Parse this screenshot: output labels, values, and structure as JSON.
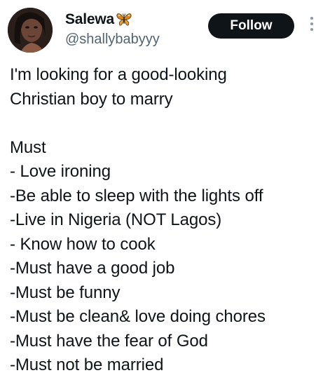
{
  "author": {
    "display_name": "Salewa",
    "name_emoji": "butterfly-icon",
    "handle": "@shallybabyyy"
  },
  "header": {
    "follow_label": "Follow"
  },
  "tweet": {
    "intro_lines": [
      "I'm looking for a good-looking",
      "Christian boy to marry"
    ],
    "list_heading": "Must",
    "requirements": [
      "- Love ironing",
      "-Be able to sleep with the lights off",
      "-Live in Nigeria (NOT Lagos)",
      "- Know how to cook",
      "-Must have a good job",
      "-Must be funny",
      "-Must be clean& love doing chores",
      "-Must have the fear of God",
      "-Must not be married"
    ]
  },
  "colors": {
    "text": "#0f1419",
    "secondary_text": "#536471",
    "follow_bg": "#0f1419",
    "follow_text": "#ffffff",
    "butterfly": "#d9891a"
  }
}
